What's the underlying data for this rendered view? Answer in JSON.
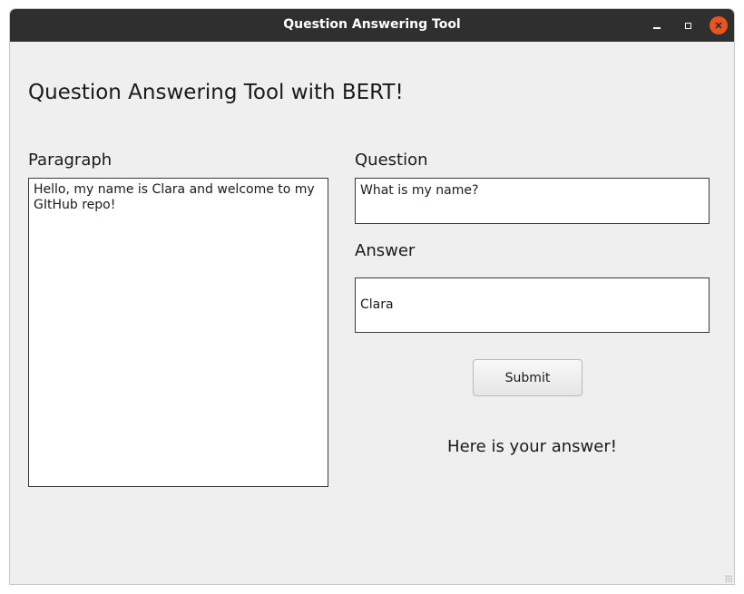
{
  "window": {
    "title": "Question Answering Tool",
    "accent_close": "#e95420",
    "titlebar_color": "#2f2f2f",
    "background_color": "#efefef"
  },
  "main": {
    "heading": "Question Answering Tool with BERT!",
    "paragraph_label": "Paragraph",
    "paragraph_text": "Hello, my name is Clara and welcome to my\nGItHub repo!",
    "question_label": "Question",
    "question_text": "What is my name?",
    "answer_label": "Answer",
    "answer_text": "Clara",
    "submit_label": "Submit",
    "status_text": "Here is your answer!"
  },
  "icons": {
    "minimize": "minimize-icon",
    "maximize": "maximize-icon",
    "close": "close-icon"
  }
}
